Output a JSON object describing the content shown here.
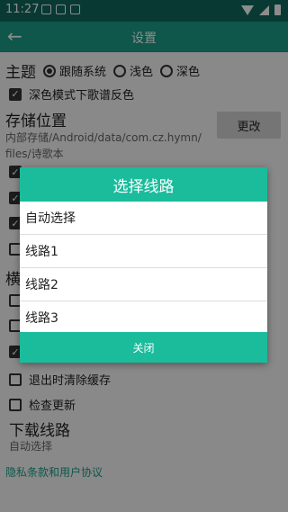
{
  "status": {
    "time": "11:27"
  },
  "toolbar": {
    "title": "设置"
  },
  "theme": {
    "label": "主题",
    "options": [
      "跟随系统",
      "浅色",
      "深色"
    ],
    "dark_invert_label": "深色模式下歌谱反色"
  },
  "storage": {
    "label": "存储位置",
    "path_line1": "内部存储/Android/data/com.cz.hymn/",
    "path_line2": "files/诗歌本",
    "change_button": "更改"
  },
  "landscape": {
    "label_partial": "横"
  },
  "settings": {
    "clear_cache_label": "退出时清除缓存",
    "check_update_label": "检查更新"
  },
  "download": {
    "label": "下载线路",
    "value": "自动选择"
  },
  "privacy_link": "隐私条款和用户协议",
  "dialog": {
    "title": "选择线路",
    "options": [
      "自动选择",
      "线路1",
      "线路2",
      "线路3"
    ],
    "close_label": "关闭"
  }
}
